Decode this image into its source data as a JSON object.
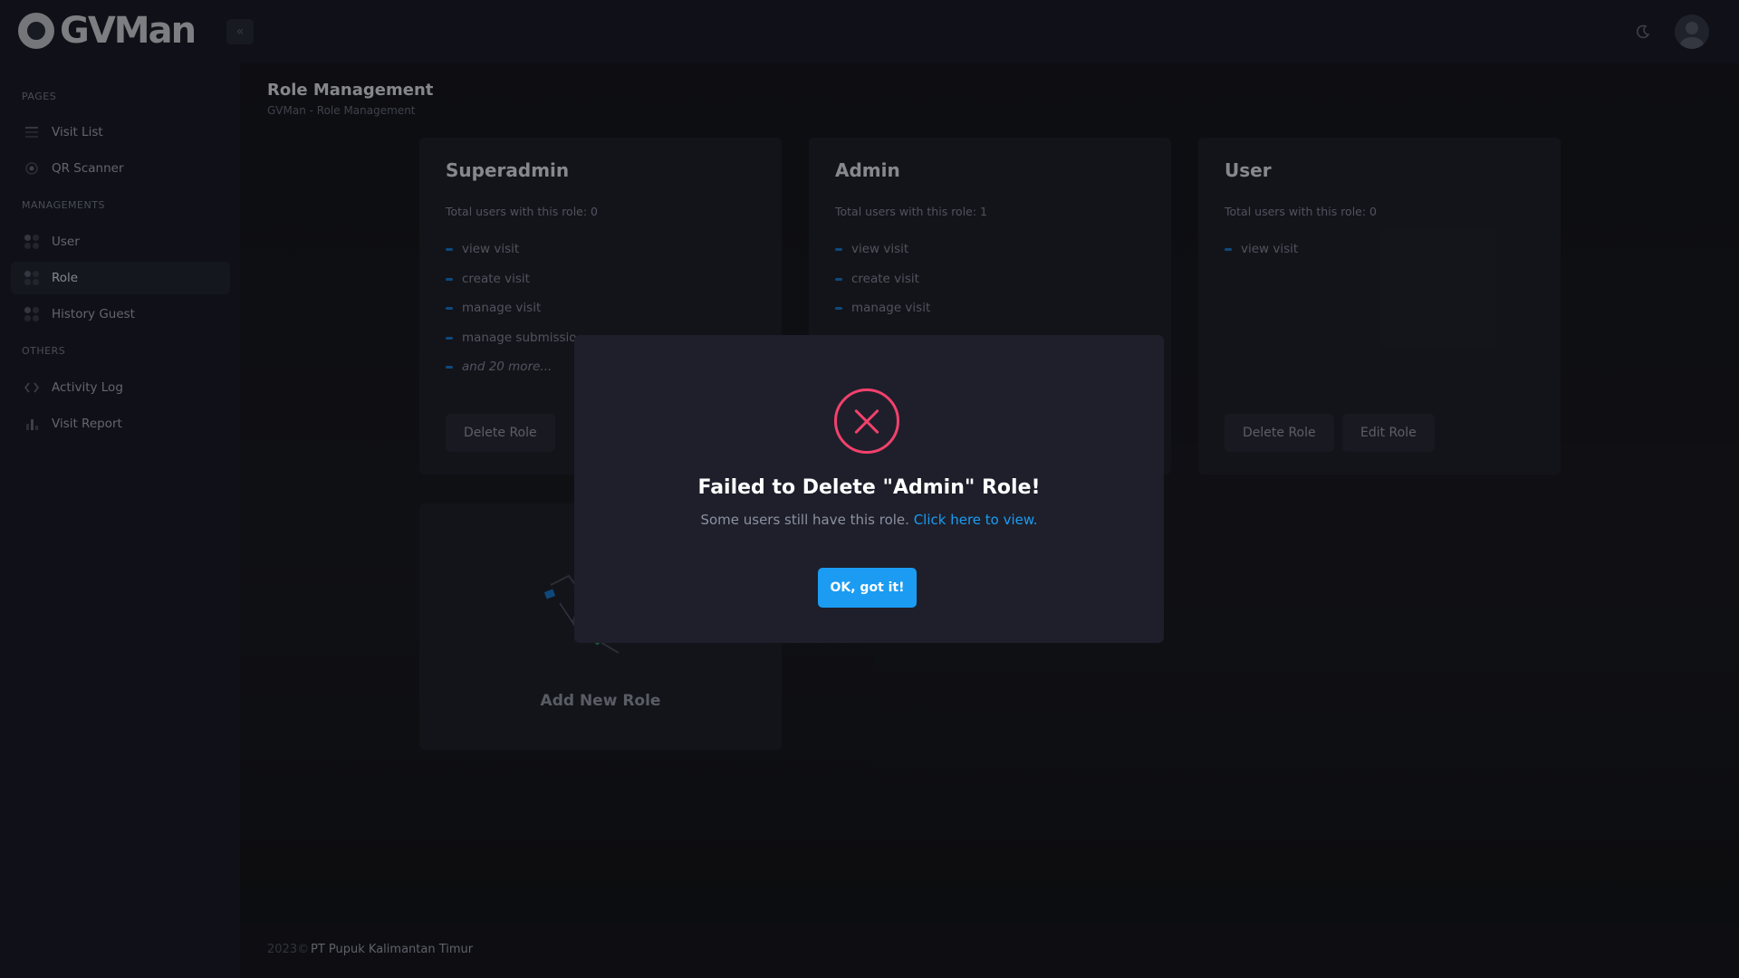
{
  "header": {
    "app_name": "GVMan",
    "collapse_icon": "chevron-double-left-icon",
    "theme_icon": "moon-icon",
    "avatar_icon": "user-avatar-icon"
  },
  "sidebar": {
    "sections": [
      {
        "title": "PAGES",
        "items": [
          {
            "label": "Visit List",
            "icon": "list-icon"
          },
          {
            "label": "QR Scanner",
            "icon": "target-icon"
          }
        ]
      },
      {
        "title": "MANAGEMENTS",
        "items": [
          {
            "label": "User",
            "icon": "grid-dots-icon"
          },
          {
            "label": "Role",
            "icon": "grid-dots-icon",
            "active": true
          },
          {
            "label": "History Guest",
            "icon": "grid-dots-icon"
          }
        ]
      },
      {
        "title": "OTHERS",
        "items": [
          {
            "label": "Activity Log",
            "icon": "code-icon"
          },
          {
            "label": "Visit Report",
            "icon": "bar-chart-icon"
          }
        ]
      }
    ]
  },
  "page": {
    "title": "Role Management",
    "breadcrumb": "GVMan - Role Management"
  },
  "roles": [
    {
      "name": "Superadmin",
      "count_text": "Total users with this role: 0",
      "permissions": [
        "view visit",
        "create visit",
        "manage visit",
        "manage submissio"
      ],
      "more": "and 20 more...",
      "delete_label": "Delete Role"
    },
    {
      "name": "Admin",
      "count_text": "Total users with this role: 1",
      "permissions": [
        "view visit",
        "create visit",
        "manage visit"
      ]
    },
    {
      "name": "User",
      "count_text": "Total users with this role: 0",
      "permissions": [
        "view visit"
      ],
      "delete_label": "Delete Role",
      "edit_label": "Edit Role"
    }
  ],
  "add_role": {
    "label": "Add New Role"
  },
  "modal": {
    "title": "Failed to Delete \"Admin\" Role!",
    "message": "Some users still have this role.",
    "link_text": "Click here to view.",
    "ok_label": "OK, got it!",
    "icon": "error-x-circle-icon"
  },
  "footer": {
    "year": "2023©",
    "company": "PT Pupuk Kalimantan Timur"
  },
  "colors": {
    "accent": "#1b9cf2",
    "danger": "#f1416c",
    "panel": "#1c1e2a"
  }
}
